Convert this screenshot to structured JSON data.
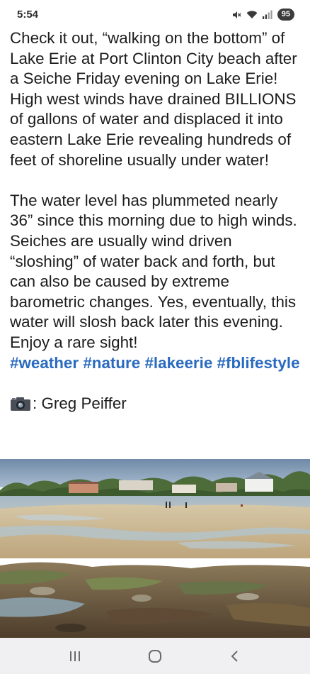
{
  "status_bar": {
    "time": "5:54",
    "battery": "95",
    "icons": [
      "mute-icon",
      "wifi-icon",
      "signal-icon",
      "battery-icon"
    ]
  },
  "post": {
    "paragraph_1": "Check it out, “walking on the bottom” of Lake Erie at Port Clinton City beach after a Seiche Friday evening on Lake Erie! High west winds have drained BILLIONS of gallons of water and displaced it into eastern Lake Erie revealing hundreds of feet of shoreline usually under water!",
    "paragraph_2": "The water level has plummeted nearly 36” since this morning due to high winds. Seiches are usually wind driven “sloshing” of water back and forth, but can also be caused by extreme barometric changes. Yes, eventually, this water will slosh back later this evening. Enjoy a rare sight!",
    "hashtags": [
      "#weather",
      "#nature",
      "#lakeerie",
      "#fblifestyle"
    ],
    "credit": ": Greg Peiffer",
    "link_color": "#2a6bbf"
  },
  "nav_bar": {
    "buttons": [
      "recent-apps-icon",
      "home-icon",
      "back-icon"
    ]
  }
}
